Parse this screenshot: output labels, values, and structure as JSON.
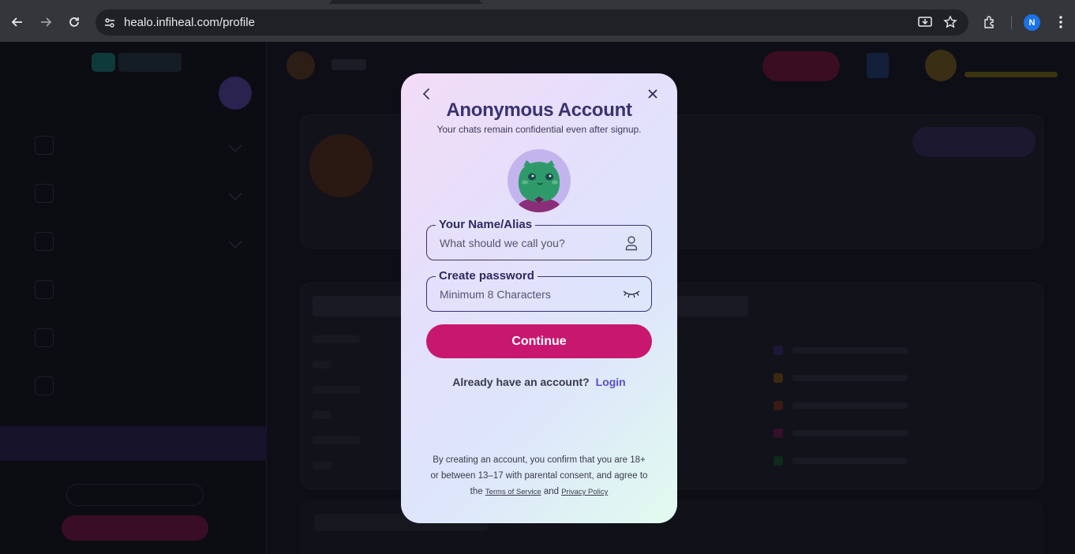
{
  "browser": {
    "url": "healo.infiheal.com/profile",
    "profile_initial": "N"
  },
  "modal": {
    "title": "Anonymous Account",
    "subtitle": "Your chats remain confidential even after signup.",
    "name_field": {
      "label": "Your Name/Alias",
      "placeholder": "What should we call you?",
      "icon": "user-icon"
    },
    "password_field": {
      "label": "Create password",
      "placeholder": "Minimum 8 Characters",
      "icon": "eye-closed-icon"
    },
    "continue_label": "Continue",
    "have_account_text": "Already have an account?",
    "login_label": "Login",
    "terms": {
      "line1": "By creating an account, you confirm that you are 18+",
      "line2": "or between 13–17 with parental consent, and agree to",
      "prefix": "the",
      "tos_label": "Terms of Service",
      "and": "and",
      "privacy_label": "Privacy Policy"
    }
  },
  "colors": {
    "accent": "#c8176f",
    "title": "#3a3370",
    "link": "#5c4cc4"
  }
}
